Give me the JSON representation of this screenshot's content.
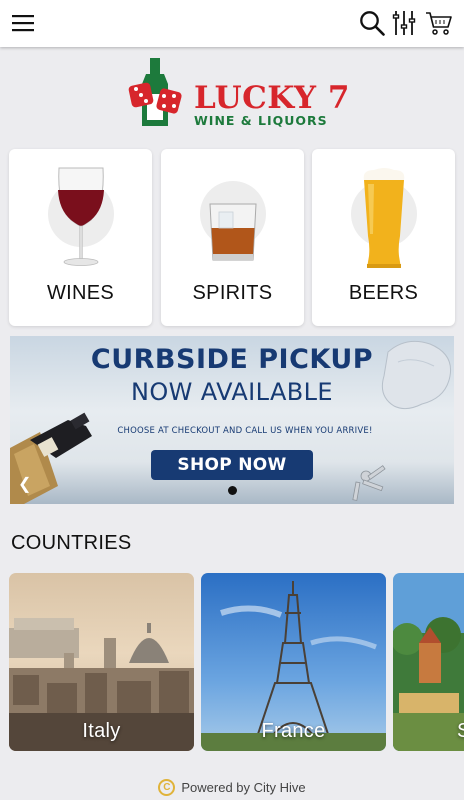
{
  "header": {
    "icons": [
      "menu-icon",
      "search-icon",
      "filter-icon",
      "cart-icon"
    ]
  },
  "logo": {
    "brand": "LUCKY 7",
    "subtitle": "WINE & LIQUORS"
  },
  "categories": [
    {
      "label": "WINES"
    },
    {
      "label": "SPIRITS"
    },
    {
      "label": "BEERS"
    }
  ],
  "banner": {
    "headline_1": "CURBSIDE PICKUP",
    "headline_2": "NOW AVAILABLE",
    "subtext": "CHOOSE AT CHECKOUT AND CALL US WHEN YOU ARRIVE!",
    "button": "SHOP NOW",
    "colors": {
      "navy": "#173a73"
    }
  },
  "countries": {
    "title": "COUNTRIES",
    "items": [
      {
        "label": "Italy"
      },
      {
        "label": "France"
      },
      {
        "label": "S"
      }
    ]
  },
  "footer": {
    "text": "Powered by City Hive"
  },
  "colors": {
    "brand_red": "#d7262c",
    "brand_green": "#1d7a3c",
    "background": "#ececef"
  }
}
